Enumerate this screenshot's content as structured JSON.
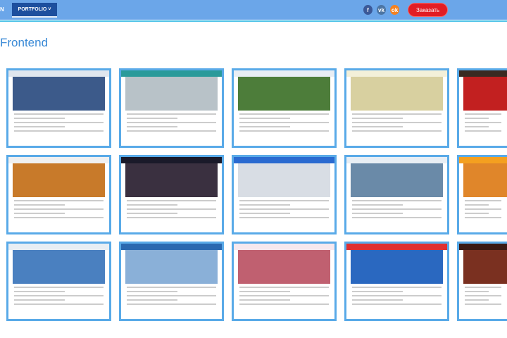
{
  "header": {
    "nav_cut_label": "N",
    "portfolio_label": "PORTFOLIO",
    "social": [
      {
        "icon": "facebook-icon",
        "glyph": "f",
        "color": "#3b5998"
      },
      {
        "icon": "vk-icon",
        "glyph": "vk",
        "color": "#4c75a3"
      },
      {
        "icon": "odnoklassniki-icon",
        "glyph": "ok",
        "color": "#f58220"
      }
    ],
    "order_label": "Заказать"
  },
  "section_title": "Frontend",
  "thumbs": [
    {
      "hdr": "#dfe6ee",
      "hero": "#3c5a8a"
    },
    {
      "hdr": "#2a9a9a",
      "hero": "#b8c2c8"
    },
    {
      "hdr": "#e8eef4",
      "hero": "#4d7d3a"
    },
    {
      "hdr": "#f3f0d9",
      "hero": "#d8d0a0"
    },
    {
      "hdr": "#3a2a22",
      "hero": "#c22020"
    },
    {
      "hdr": "#f0f0f0",
      "hero": "#c87a2a"
    },
    {
      "hdr": "#1a1a2a",
      "hero": "#3a3040"
    },
    {
      "hdr": "#2a6ad0",
      "hero": "#d8dde4"
    },
    {
      "hdr": "#e8eef4",
      "hero": "#6a8aa8"
    },
    {
      "hdr": "#f4a020",
      "hero": "#e0862a"
    },
    {
      "hdr": "#e8eef4",
      "hero": "#4a80c0"
    },
    {
      "hdr": "#2a68b0",
      "hero": "#8ab0d8"
    },
    {
      "hdr": "#f7e8ee",
      "hero": "#c06070"
    },
    {
      "hdr": "#e03030",
      "hero": "#2a68c0"
    },
    {
      "hdr": "#3a1a14",
      "hero": "#7a3020"
    }
  ]
}
